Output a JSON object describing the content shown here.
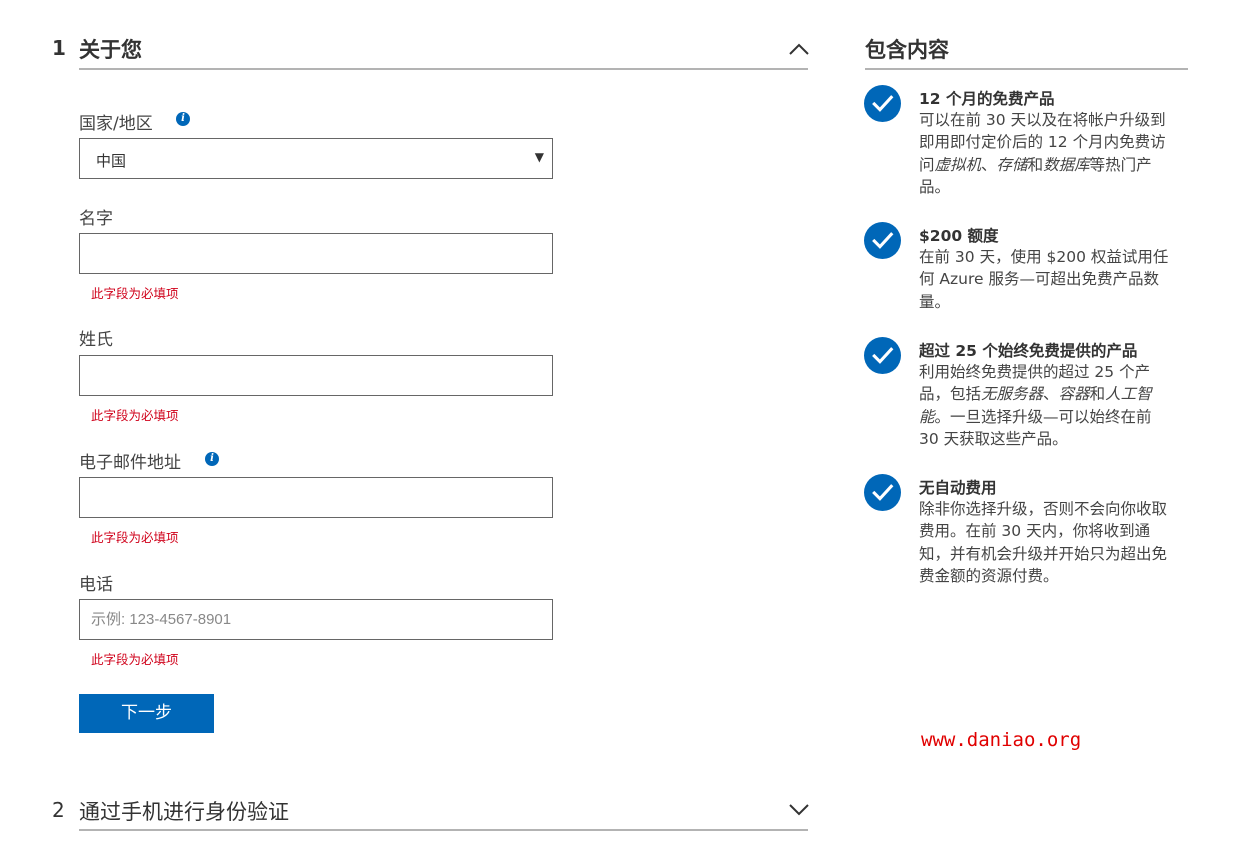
{
  "section1": {
    "number": "1",
    "title": "关于您"
  },
  "section2": {
    "number": "2",
    "title": "通过手机进行身份验证"
  },
  "form": {
    "country": {
      "label": "国家/地区",
      "value": "中国",
      "arrow": "▼"
    },
    "first_name": {
      "label": "名字",
      "value": "",
      "error": "此字段为必填项"
    },
    "last_name": {
      "label": "姓氏",
      "value": "",
      "error": "此字段为必填项"
    },
    "email": {
      "label": "电子邮件地址",
      "value": "",
      "error": "此字段为必填项"
    },
    "phone": {
      "label": "电话",
      "value": "",
      "placeholder": "示例: 123-4567-8901",
      "error": "此字段为必填项"
    },
    "info_glyph": "i",
    "next_button": "下一步"
  },
  "included": {
    "title": "包含内容",
    "items": [
      {
        "title": "12 个月的免费产品",
        "desc_lines": [
          [
            {
              "t": "可以在前 30 天以及在将帐户升级到"
            }
          ],
          [
            {
              "t": "即用即付定价后的 12 个月内免费访"
            }
          ],
          [
            {
              "t": "问"
            },
            {
              "t": "虚拟机",
              "i": true
            },
            {
              "t": "、"
            },
            {
              "t": "存储",
              "i": true
            },
            {
              "t": "和"
            },
            {
              "t": "数据库",
              "i": true
            },
            {
              "t": "等热门产"
            }
          ],
          [
            {
              "t": "品。"
            }
          ]
        ]
      },
      {
        "title": "$200 额度",
        "desc_lines": [
          [
            {
              "t": "在前 30 天，使用 $200 权益试用任"
            }
          ],
          [
            {
              "t": "何 Azure 服务—可超出免费产品数"
            }
          ],
          [
            {
              "t": "量。"
            }
          ]
        ]
      },
      {
        "title": "超过 25 个始终免费提供的产品",
        "desc_lines": [
          [
            {
              "t": "利用始终免费提供的超过 25 个产"
            }
          ],
          [
            {
              "t": "品，包括"
            },
            {
              "t": "无服务器",
              "i": true
            },
            {
              "t": "、"
            },
            {
              "t": "容器",
              "i": true
            },
            {
              "t": "和"
            },
            {
              "t": "人工智",
              "i": true
            }
          ],
          [
            {
              "t": "能",
              "i": true
            },
            {
              "t": "。一旦选择升级—可以始终在前"
            }
          ],
          [
            {
              "t": "30 天获取这些产品。"
            }
          ]
        ]
      },
      {
        "title": "无自动费用",
        "desc_lines": [
          [
            {
              "t": "除非你选择升级，否则不会向你收取"
            }
          ],
          [
            {
              "t": "费用。在前 30 天内，你将收到通"
            }
          ],
          [
            {
              "t": "知，并有机会升级并开始只为超出免"
            }
          ],
          [
            {
              "t": "费金额的资源付费。"
            }
          ]
        ]
      }
    ]
  },
  "watermark": "www.daniao.org",
  "colors": {
    "accent": "#0067b8",
    "error": "#d0021b",
    "watermark": "#e00000"
  },
  "icons": [
    "chevron-up-icon",
    "chevron-down-icon",
    "info-icon",
    "check-circle-icon"
  ]
}
